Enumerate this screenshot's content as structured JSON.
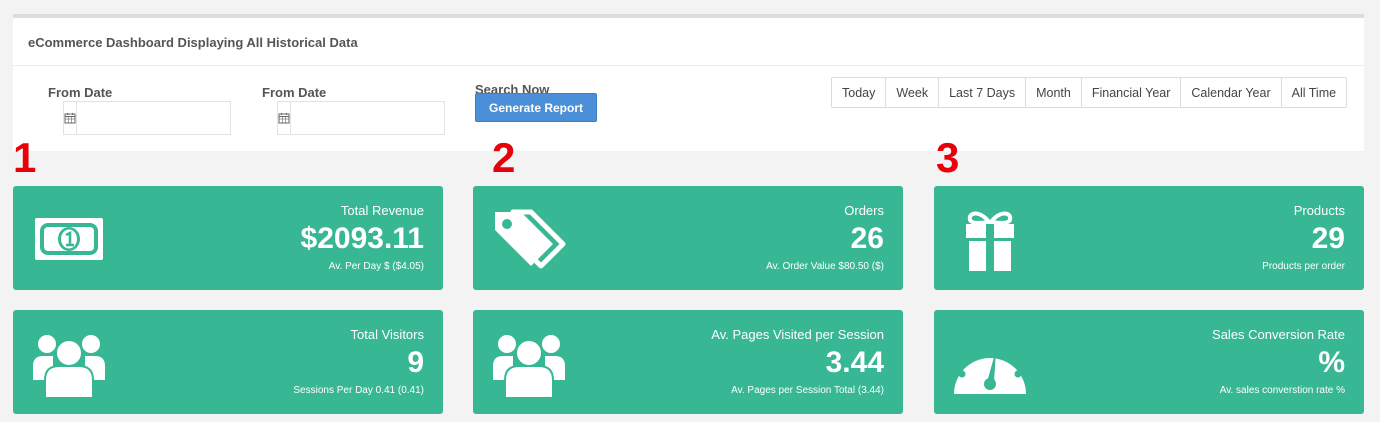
{
  "panel": {
    "title": "eCommerce Dashboard Displaying All Historical Data"
  },
  "filters": {
    "from_date_1": {
      "label": "From Date",
      "value": "",
      "placeholder": ""
    },
    "from_date_2": {
      "label": "From Date",
      "value": "",
      "placeholder": ""
    },
    "search_label": "Search Now",
    "generate_button": "Generate Report",
    "ranges": [
      "Today",
      "Week",
      "Last 7 Days",
      "Month",
      "Financial Year",
      "Calendar Year",
      "All Time"
    ]
  },
  "markers": [
    "1",
    "2",
    "3"
  ],
  "cards": [
    {
      "icon": "money-bill-icon",
      "title": "Total Revenue",
      "value": "$2093.11",
      "sub": "Av. Per Day $ ($4.05)"
    },
    {
      "icon": "tags-icon",
      "title": "Orders",
      "value": "26",
      "sub": "Av. Order Value $80.50 ($)"
    },
    {
      "icon": "gift-icon",
      "title": "Products",
      "value": "29",
      "sub": "Products per order"
    },
    {
      "icon": "users-icon",
      "title": "Total Visitors",
      "value": "9",
      "sub": "Sessions Per Day 0.41 (0.41)"
    },
    {
      "icon": "users-icon",
      "title": "Av. Pages Visited per Session",
      "value": "3.44",
      "sub": "Av. Pages per Session Total (3.44)"
    },
    {
      "icon": "dashboard-gauge-icon",
      "title": "Sales Conversion Rate",
      "value": "%",
      "sub": "Av. sales converstion rate %"
    }
  ],
  "colors": {
    "card_bg": "#37b794",
    "button_primary": "#4a8fd8",
    "marker_red": "#e8000b"
  }
}
